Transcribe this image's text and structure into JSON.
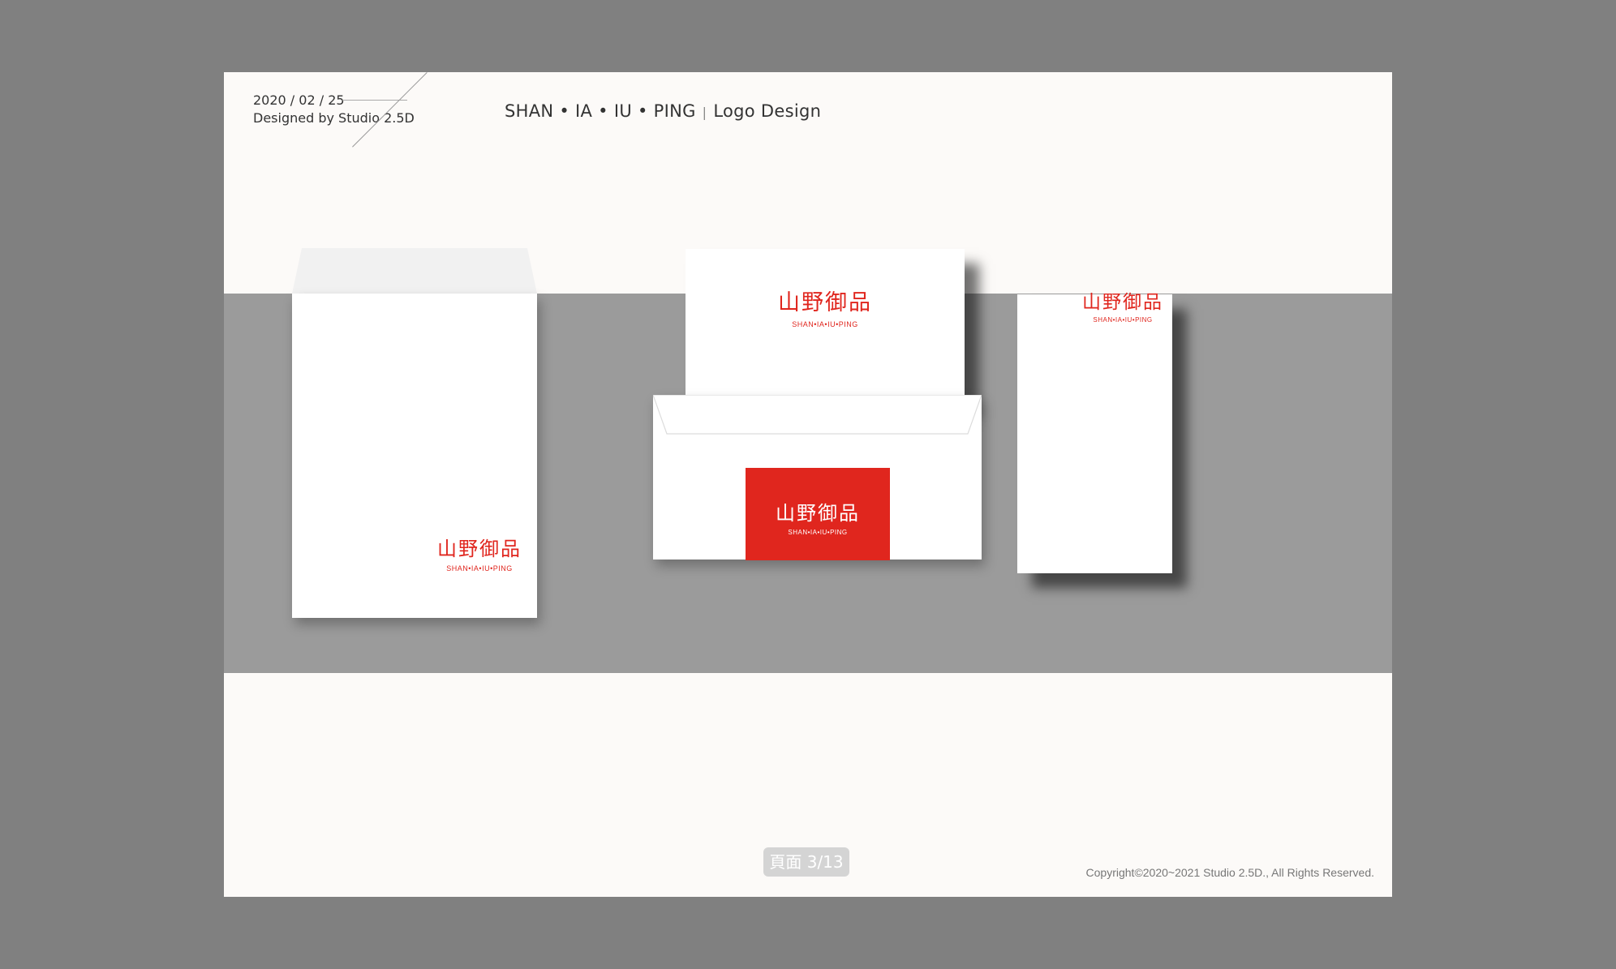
{
  "header": {
    "date": "2020 / 02 / 25",
    "designer": "Designed by Studio 2.5D",
    "title_main": "SHAN • IA • IU • PING",
    "title_separator": "|",
    "title_sub": "Logo Design"
  },
  "logo": {
    "chinese": "山野御品",
    "english": "SHAN•IA•IU•PING"
  },
  "footer": {
    "pager": "頁面 3/13",
    "copyright": "Copyright©2020~2021 Studio 2.5D., All Rights Reserved."
  },
  "colors": {
    "brand_red": "#e0261e",
    "band_gray": "#9b9b9b",
    "page_background": "#fcfaf8",
    "outer_background": "#808080"
  }
}
